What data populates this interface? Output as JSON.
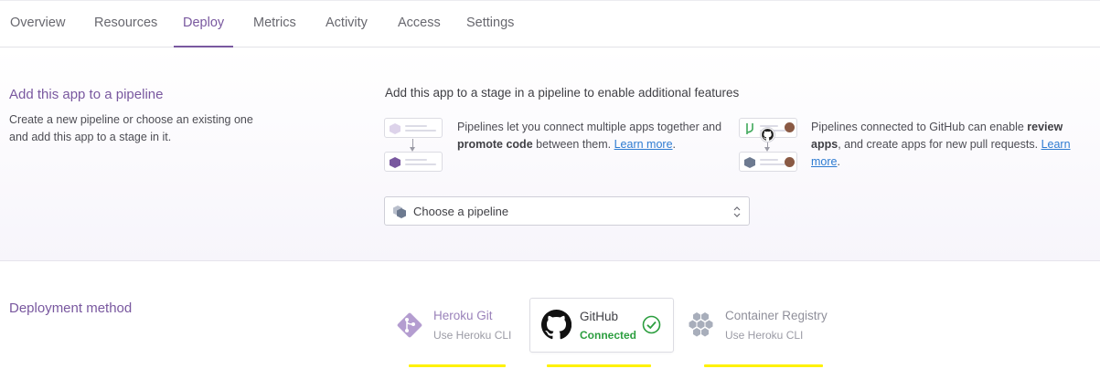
{
  "tabs": [
    {
      "label": "Overview",
      "active": false
    },
    {
      "label": "Resources",
      "active": false
    },
    {
      "label": "Deploy",
      "active": true
    },
    {
      "label": "Metrics",
      "active": false
    },
    {
      "label": "Activity",
      "active": false
    },
    {
      "label": "Access",
      "active": false
    },
    {
      "label": "Settings",
      "active": false
    }
  ],
  "pipeline": {
    "title": "Add this app to a pipeline",
    "description": "Create a new pipeline or choose an existing one and add this app to a stage in it.",
    "stage_heading": "Add this app to a stage in a pipeline to enable additional features",
    "feature_promote": {
      "text_before": "Pipelines let you connect multiple apps together and ",
      "bold": "promote code",
      "text_after": " between them.",
      "link": "Learn more",
      "link_suffix": "."
    },
    "feature_review": {
      "text_before": "Pipelines connected to GitHub can enable ",
      "bold": "review apps",
      "text_after": ", and create apps for new pull requests.",
      "link": "Learn more",
      "link_suffix": "."
    },
    "select_placeholder": "Choose a pipeline"
  },
  "deployment": {
    "title": "Deployment method",
    "methods": [
      {
        "name": "Heroku Git",
        "sub": "Use Heroku CLI",
        "icon": "heroku-git-icon",
        "selected": false
      },
      {
        "name": "GitHub",
        "sub": "Connected",
        "icon": "github-icon",
        "selected": true,
        "status": "connected"
      },
      {
        "name": "Container Registry",
        "sub": "Use Heroku CLI",
        "icon": "container-registry-icon",
        "selected": false
      }
    ]
  },
  "colors": {
    "accent": "#79589f",
    "link": "#2d7bd1",
    "connected": "#2c9e3f",
    "highlight": "#fff200"
  }
}
